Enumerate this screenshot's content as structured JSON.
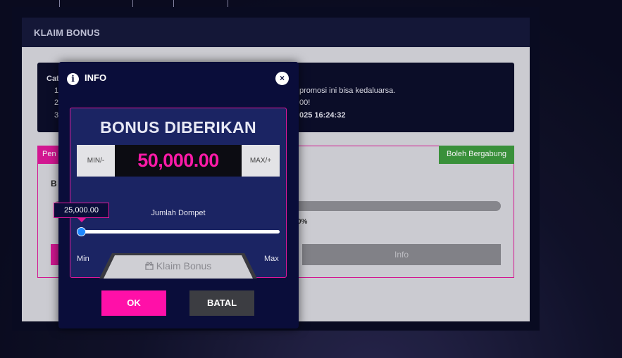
{
  "background": {
    "top_inputs": [
      "",
      ""
    ]
  },
  "panel": {
    "title": "KLAIM BONUS",
    "info": {
      "heading": "Cat",
      "numbers": [
        "1",
        "2",
        "3"
      ],
      "lines": [
        "promosi ini bisa kedaluarsa.",
        "00!",
        "025 16:24:32"
      ]
    },
    "card": {
      "tab_left": "Pen",
      "tab_right": "Boleh Bergabung",
      "title": "B",
      "progress_text": "0%",
      "info_button": "Info"
    }
  },
  "modal": {
    "title": "INFO",
    "close_label": "×",
    "heading": "BONUS DIBERIKAN",
    "min_label": "MIN/-",
    "amount": "50,000.00",
    "max_label": "MAX/+",
    "slider_label": "Jumlah Dompet",
    "slider_tooltip": "25,000.00",
    "slider_min": "Min",
    "slider_max": "Max",
    "claim_button": "Klaim Bonus",
    "ok_button": "OK",
    "cancel_button": "BATAL"
  },
  "colors": {
    "accent_pink": "#e0189a",
    "ok_pink": "#ff10a8",
    "amount_pink": "#ff1aa8",
    "green": "#3d9a3d",
    "modal_bg": "#0a0d3a",
    "slider_handle": "#1e88ff"
  }
}
